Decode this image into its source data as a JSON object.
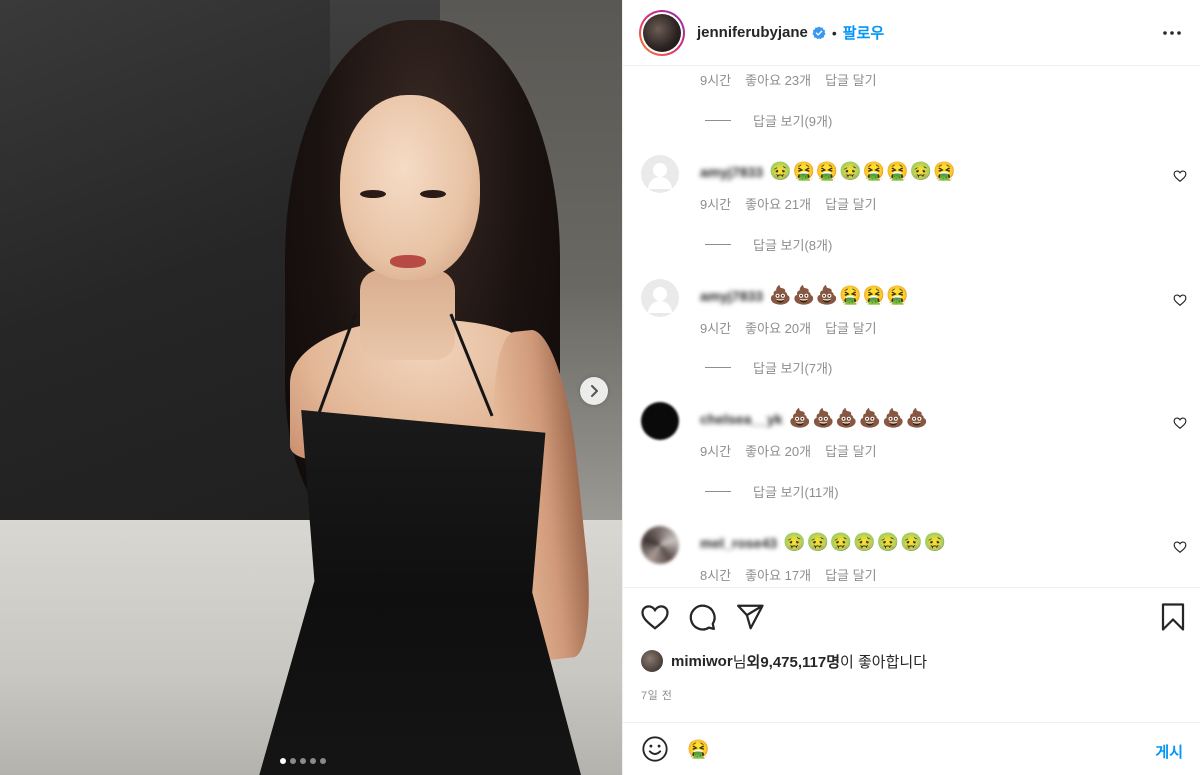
{
  "post": {
    "username": "jenniferubyjane",
    "follow_label": "팔로우",
    "dot": "•"
  },
  "comments": [
    {
      "avatar": "none",
      "username": "",
      "text": "",
      "time": "9시간",
      "likes": "좋아요 23개",
      "reply": "답글 달기",
      "view_replies": "답글 보기(9개)"
    },
    {
      "avatar": "default",
      "username": "amyj7833",
      "text": "🤢🤮🤮🤢🤮🤮🤢🤮",
      "time": "9시간",
      "likes": "좋아요 21개",
      "reply": "답글 달기",
      "view_replies": "답글 보기(8개)"
    },
    {
      "avatar": "default",
      "username": "amyj7833",
      "text": "💩💩💩🤮🤮🤮",
      "time": "9시간",
      "likes": "좋아요 20개",
      "reply": "답글 달기",
      "view_replies": "답글 보기(7개)"
    },
    {
      "avatar": "dark",
      "username": "chelsea__yk",
      "text": "💩💩💩💩💩💩",
      "time": "9시간",
      "likes": "좋아요 20개",
      "reply": "답글 달기",
      "view_replies": "답글 보기(11개)"
    },
    {
      "avatar": "mosaic",
      "username": "mel_rose43",
      "text": "🤢🤢🤢🤢🤢🤢🤢",
      "time": "8시간",
      "likes": "좋아요 17개",
      "reply": "답글 달기",
      "view_replies": ""
    }
  ],
  "likes_line": {
    "liker": "mimiwor",
    "suffix_1": "님 ",
    "and_label": "외",
    "count": " 9,475,117명",
    "suffix_2": "이 좋아합니다"
  },
  "timestamp": "7일 전",
  "input": {
    "value": "🤮",
    "post_label": "게시"
  },
  "colors": {
    "accent": "#0095f6",
    "muted": "#8e8e8e",
    "text": "#262626"
  },
  "icons": {
    "header_more": "more-horizontal-icon",
    "verified": "verified-badge-icon",
    "like": "heart-icon",
    "comment": "comment-bubble-icon",
    "share": "paper-plane-icon",
    "save": "bookmark-icon",
    "emoji": "smiley-icon",
    "carousel_next": "chevron-right-icon"
  },
  "carousel": {
    "slides": 5,
    "active": 1
  }
}
